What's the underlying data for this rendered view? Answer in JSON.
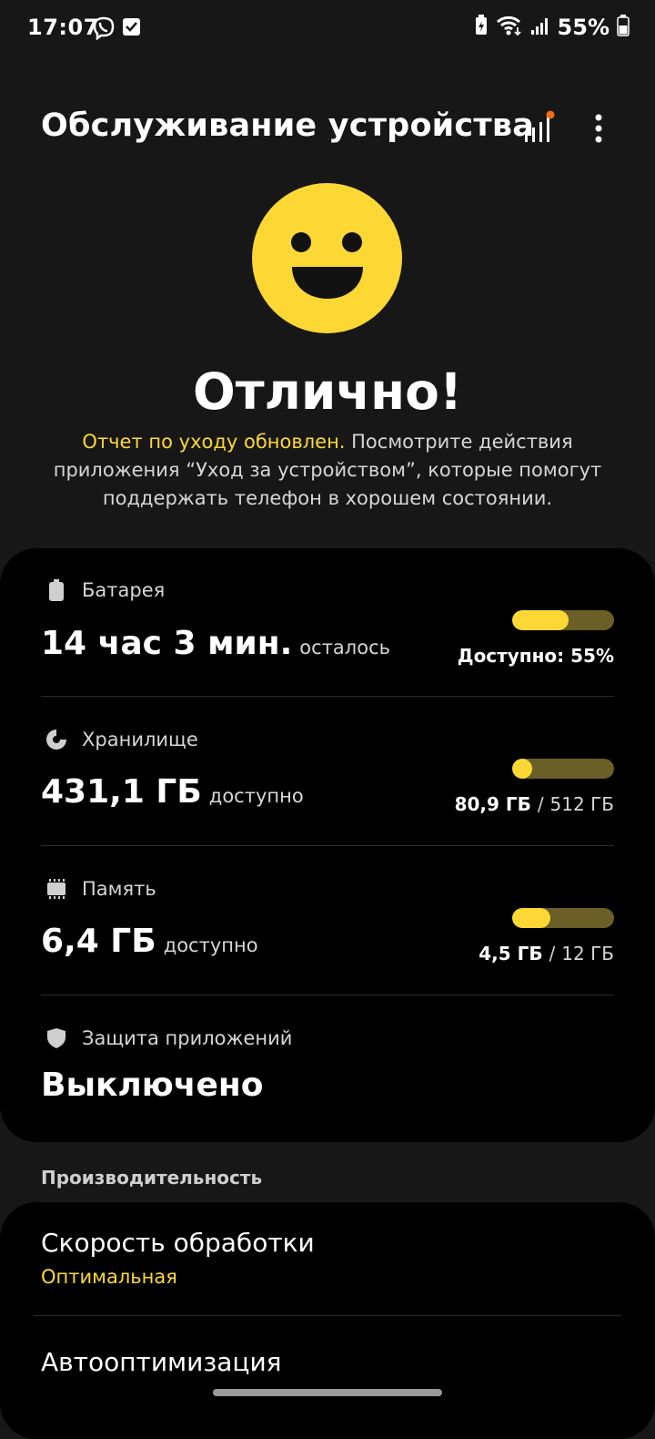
{
  "status_bar": {
    "time": "17:07",
    "battery_percent": "55%",
    "left_icons": [
      "viber-icon",
      "check-box-icon"
    ],
    "right_icons": [
      "battery-saver-icon",
      "wifi-icon",
      "signal-icon",
      "battery-icon"
    ]
  },
  "header": {
    "title": "Обслуживание устройства",
    "buttons": [
      "signal-bars-notification-icon",
      "more-options-icon"
    ]
  },
  "status": {
    "icon": "smiley-face-icon",
    "title": "Отлично!",
    "description_accent": "Отчет по уходу обновлен.",
    "description_rest": " Посмотрите действия приложения “Уход за устройством”, которые помогут поддержать телефон в хорошем состоянии."
  },
  "battery": {
    "icon": "battery-icon",
    "label": "Батарея",
    "value": "14 час 3 мин.",
    "suffix": "осталось",
    "right_text": "Доступно: 55%",
    "level": 0.55
  },
  "storage": {
    "icon": "storage-pie-icon",
    "label": "Хранилище",
    "value": "431,1 ГБ",
    "suffix": "доступно",
    "used": "80,9 ГБ",
    "separator": "/",
    "total": "512 ГБ",
    "level": 0.158
  },
  "memory": {
    "icon": "memory-chip-icon",
    "label": "Память",
    "value": "6,4 ГБ",
    "suffix": "доступно",
    "used": "4,5 ГБ",
    "separator": "/",
    "total": "12 ГБ",
    "level": 0.375
  },
  "app_protection": {
    "icon": "shield-icon",
    "label": "Защита приложений",
    "value": "Выключено"
  },
  "performance": {
    "section_label": "Производительность",
    "items": [
      {
        "title": "Скорость обработки",
        "subtitle": "Оптимальная"
      },
      {
        "title": "Автооптимизация"
      }
    ]
  },
  "colors": {
    "accent": "#fdd835",
    "background": "#171717",
    "card": "#000000",
    "bar_track": "#6a5f27"
  }
}
